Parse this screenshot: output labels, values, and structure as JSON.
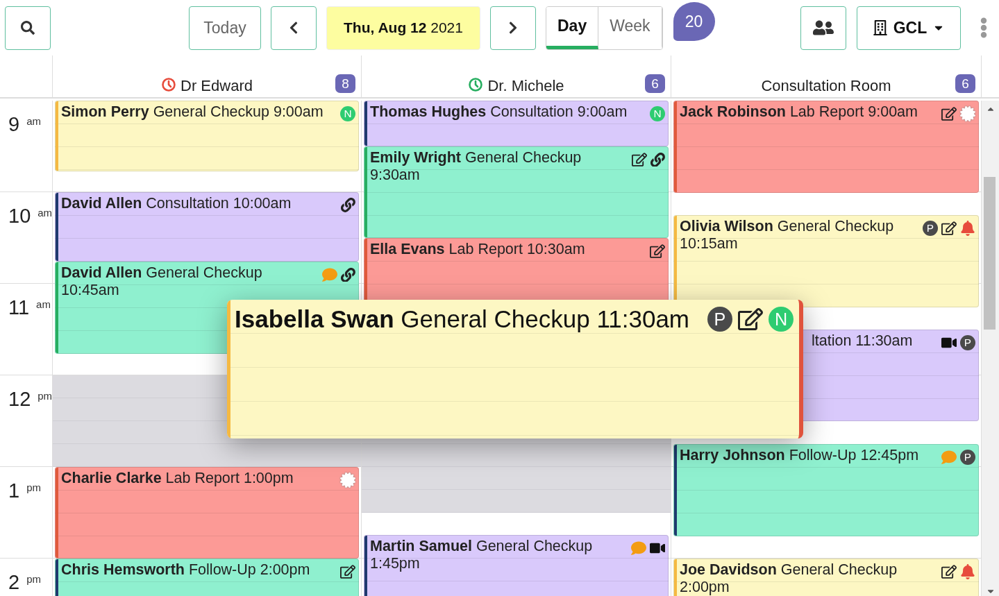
{
  "toolbar": {
    "today": "Today",
    "date": "**Thu, Aug 12** 2021",
    "views": [
      {
        "label": "Day",
        "selected": true
      },
      {
        "label": "Week",
        "selected": false
      }
    ],
    "total": "20",
    "location": "GCL"
  },
  "time_slots": [
    {
      "hour": "9",
      "period": "am"
    },
    {
      "hour": "10",
      "period": "am"
    },
    {
      "hour": "11",
      "period": "am"
    },
    {
      "hour": "12",
      "period": "pm"
    },
    {
      "hour": "1",
      "period": "pm"
    },
    {
      "hour": "2",
      "period": "pm"
    }
  ],
  "columns": [
    {
      "name": "Dr Edward",
      "count": "8",
      "clock": {
        "color": "#e74c3c"
      },
      "events": [
        {
          "title": "**Simon Perry** General Checkup 9:00am",
          "color": "#fdf7c3",
          "stripe": {
            "color": "#f5b942"
          },
          "icons": [
            {
              "kind": "badge",
              "text": "N",
              "color": "#2ecc71"
            }
          ]
        },
        {
          "title": "**David Allen** Consultation 10:00am",
          "color": "#d9c9fb",
          "stripe": {
            "color": "#1f3a6e"
          },
          "icons": [
            {
              "kind": "link"
            }
          ]
        },
        {
          "title": "**David Allen** General Checkup 10:45am",
          "color": "#8ff0cf",
          "stripe": {
            "color": "#27ae60"
          },
          "icons": [
            {
              "kind": "comment"
            },
            {
              "kind": "link"
            }
          ]
        },
        {
          "title": "**Charlie Clarke** Lab Report 1:00pm",
          "color": "#fc9a96",
          "stripe": {
            "color": "#e05a3c"
          },
          "icons": [
            {
              "kind": "seal"
            }
          ]
        },
        {
          "title": "**Chris Hemsworth** Follow-Up 2:00pm",
          "color": "#8ff0cf",
          "stripe": {
            "color": "#1f3a6e"
          },
          "icons": [
            {
              "kind": "edit"
            }
          ]
        }
      ]
    },
    {
      "name": "Dr. Michele",
      "count": "6",
      "clock": {
        "color": "#27ae60"
      },
      "events": [
        {
          "title": "**Thomas Hughes** Consultation 9:00am",
          "color": "#d9c9fb",
          "stripe": {
            "color": "#1f3a6e"
          },
          "icons": [
            {
              "kind": "badge",
              "text": "N",
              "color": "#2ecc71"
            }
          ]
        },
        {
          "title": "**Emily Wright** General Checkup 9:30am",
          "color": "#8ff0cf",
          "stripe": {
            "color": "#27ae60"
          },
          "icons": [
            {
              "kind": "edit"
            },
            {
              "kind": "link"
            }
          ]
        },
        {
          "title": "**Ella Evans** Lab Report 10:30am",
          "color": "#fc9a96",
          "stripe": {
            "color": "#e05a3c"
          },
          "icons": [
            {
              "kind": "edit"
            }
          ]
        },
        {
          "title": "**Martin Samuel** General Checkup 1:45pm",
          "color": "#d9c9fb",
          "stripe": {
            "color": "#1f3a6e"
          },
          "icons": [
            {
              "kind": "comment"
            },
            {
              "kind": "video"
            }
          ]
        }
      ]
    },
    {
      "name": "Consultation Room",
      "count": "6",
      "events": [
        {
          "title": "**Jack Robinson** Lab Report 9:00am",
          "color": "#fc9a96",
          "stripe": {
            "color": "#e05a3c"
          },
          "icons": [
            {
              "kind": "edit"
            },
            {
              "kind": "seal"
            }
          ]
        },
        {
          "title": "**Olivia Wilson** General Checkup 10:15am",
          "color": "#fdf7c3",
          "stripe": {
            "color": "#f5b942"
          },
          "icons": [
            {
              "kind": "badge",
              "text": "P",
              "color": "#4a4a4a"
            },
            {
              "kind": "edit"
            },
            {
              "kind": "bell"
            }
          ]
        },
        {
          "title": "ltation 11:30am",
          "color": "#d9c9fb",
          "icons": [
            {
              "kind": "video"
            },
            {
              "kind": "badge",
              "text": "P",
              "color": "#4a4a4a"
            }
          ]
        },
        {
          "title": "**Harry Johnson** Follow-Up 12:45pm",
          "color": "#8ff0cf",
          "stripe": {
            "color": "#1f3a6e"
          },
          "icons": [
            {
              "kind": "comment"
            },
            {
              "kind": "badge",
              "text": "P",
              "color": "#4a4a4a"
            }
          ]
        },
        {
          "title": "**Joe Davidson** General Checkup 2:00pm",
          "color": "#fdf7c3",
          "stripe": {
            "color": "#f5b942"
          },
          "icons": [
            {
              "kind": "edit"
            },
            {
              "kind": "bell"
            }
          ]
        }
      ]
    }
  ],
  "popup": {
    "title": "**Isabella Swan** General Checkup 11:30am",
    "color": "#fdf7c3",
    "stripe": {
      "color": "#f5b942"
    },
    "icons": [
      {
        "kind": "badge",
        "text": "P",
        "color": "#4a4a4a"
      },
      {
        "kind": "edit"
      },
      {
        "kind": "badge",
        "text": "N",
        "color": "#2ecc71"
      }
    ]
  }
}
